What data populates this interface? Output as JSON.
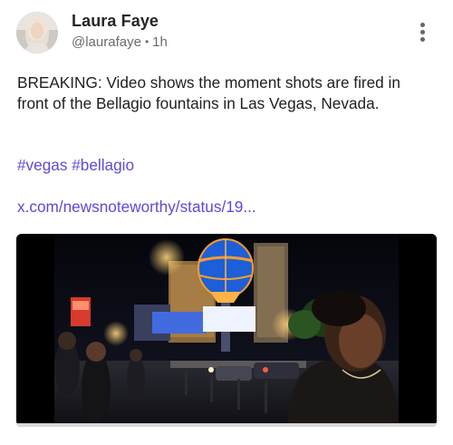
{
  "post": {
    "author_name": "Laura Faye",
    "handle": "@laurafaye",
    "separator": "•",
    "time": "1h",
    "text": "BREAKING: Video shows the moment shots are fired in front of the Bellagio fountains in Las Vegas, Nevada.",
    "hashtags": [
      "#vegas",
      "#bellagio"
    ],
    "link_text": "x.com/newsnoteworthy/status/19...",
    "menu_icon": "more-vertical-icon"
  },
  "colors": {
    "link": "#5b4bd6",
    "text": "#1f1f1f",
    "muted": "#6b6b6b"
  },
  "video": {
    "progress": 0.0
  }
}
